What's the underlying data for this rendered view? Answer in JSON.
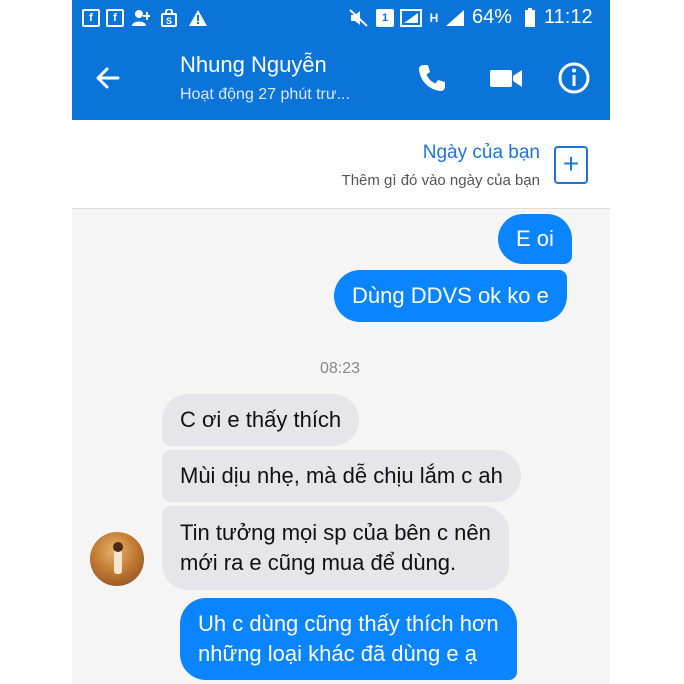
{
  "status_bar": {
    "left_icons": [
      "facebook-icon",
      "facebook-icon",
      "person-add-icon",
      "shopping-bag-icon",
      "warning-icon"
    ],
    "sim_label": "1",
    "network_label": "H",
    "battery_pct": "64%",
    "time": "11:12"
  },
  "header": {
    "contact_name": "Nhung Nguyễn",
    "contact_status": "Hoạt động 27 phút trư...",
    "accent": "#0a74d8"
  },
  "my_day": {
    "title": "Ngày của bạn",
    "subtitle": "Thêm gì đó vào ngày của bạn",
    "add_label": "+"
  },
  "messages": {
    "m1": "E oi",
    "m2": "Dùng DDVS ok ko e",
    "timestamp": "08:23",
    "m3": "C ơi e thấy thích",
    "m4": "Mùi dịu nhẹ, mà dễ chịu lắm c ah",
    "m5_line1": "Tin tưởng mọi sp của bên c nên",
    "m5_line2": "mới ra e cũng mua để dùng.",
    "m6_line1": "Uh c dùng cũng thấy thích hơn",
    "m6_line2": "những loại khác đã dùng e ạ"
  },
  "colors": {
    "outgoing_bubble": "#0a84ff",
    "incoming_bubble": "#e5e5ea"
  }
}
